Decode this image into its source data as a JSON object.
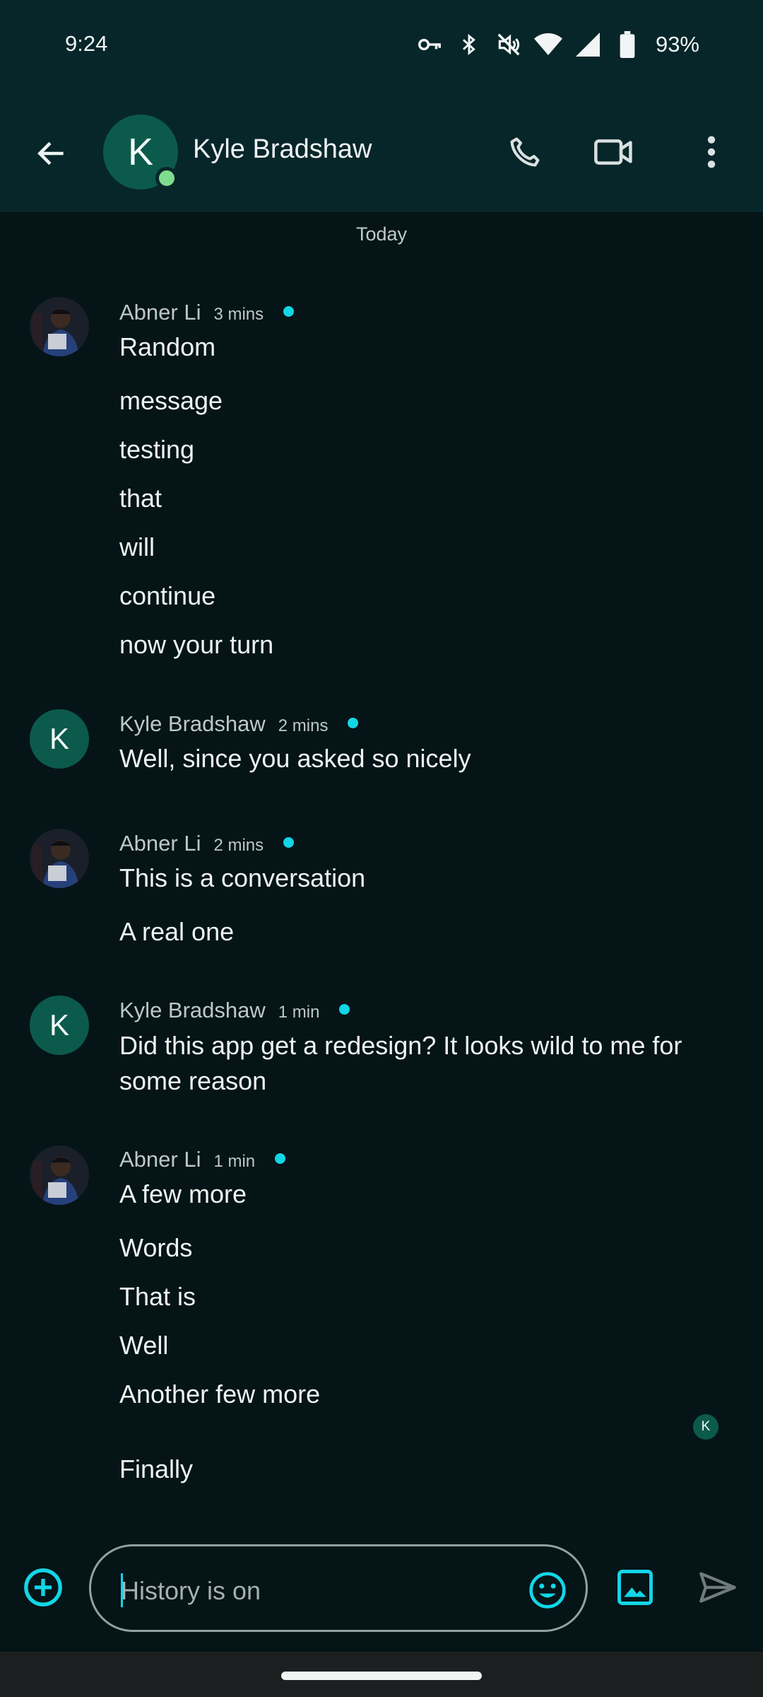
{
  "status_bar": {
    "time": "9:24",
    "battery_text": "93%",
    "icons": [
      "vpn-key-icon",
      "bluetooth-icon",
      "mute-icon",
      "wifi-icon",
      "cellular-icon",
      "battery-icon"
    ]
  },
  "app_bar": {
    "contact_initial": "K",
    "contact_name": "Kyle Bradshaw",
    "actions": [
      "back-arrow-icon",
      "phone-icon",
      "video-call-icon",
      "more-vert-icon"
    ]
  },
  "date_separator": "Today",
  "messages": [
    {
      "sender": "Abner Li",
      "time": "3 mins",
      "avatar": "photo",
      "lines": [
        "Random",
        "message",
        "testing",
        "that",
        "will",
        "continue",
        "now your turn"
      ]
    },
    {
      "sender": "Kyle Bradshaw",
      "time": "2 mins",
      "avatar": "K",
      "lines": [
        "Well, since you asked so nicely"
      ]
    },
    {
      "sender": "Abner Li",
      "time": "2 mins",
      "avatar": "photo",
      "lines": [
        "This is a conversation",
        "A real one"
      ]
    },
    {
      "sender": "Kyle Bradshaw",
      "time": "1 min",
      "avatar": "K",
      "lines": [
        "Did this app get a redesign? It looks wild to me for some reason"
      ]
    },
    {
      "sender": "Abner Li",
      "time": "1 min",
      "avatar": "photo",
      "lines": [
        "A few more",
        "Words",
        "That is",
        "Well",
        "Another few more",
        "Finally"
      ]
    }
  ],
  "read_receipt_initial": "K",
  "composer": {
    "placeholder": "History is on"
  },
  "colors": {
    "accent": "#12d6e6",
    "avatar_green": "#0c5a4c",
    "presence": "#7fdc8e",
    "background": "#051417",
    "app_bar": "#072629"
  }
}
